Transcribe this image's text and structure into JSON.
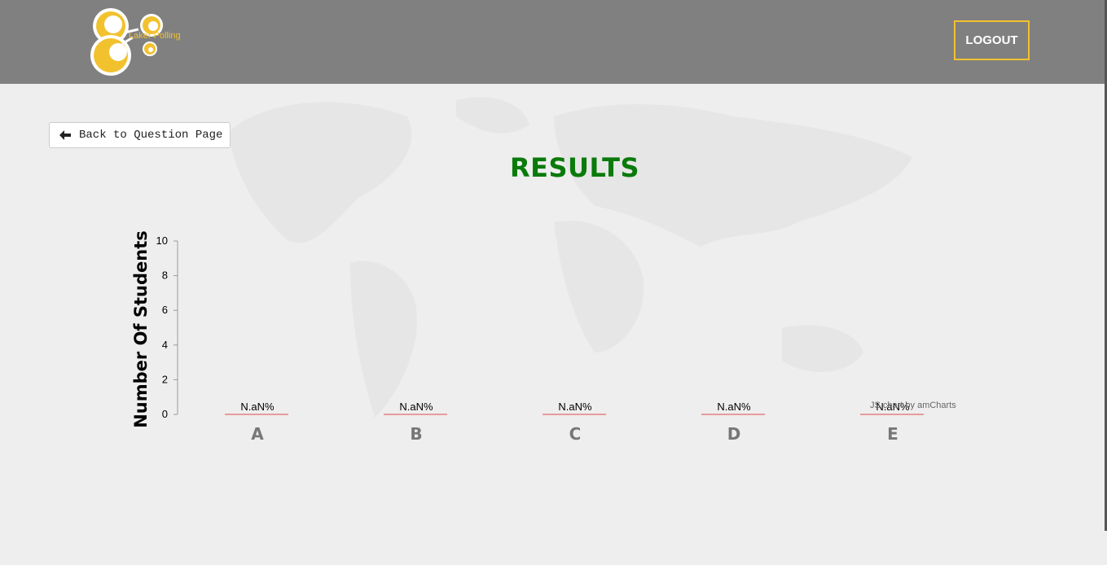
{
  "header": {
    "logo_text": "Laker Polling",
    "logout_label": "LOGOUT"
  },
  "nav": {
    "back_label": "Back to Question Page"
  },
  "page": {
    "title": "RESULTS"
  },
  "credit": "JS chart by amCharts",
  "colors": {
    "header_bg": "#808080",
    "accent_yellow": "#f2c12e",
    "title_green": "#0a7a0a",
    "bar_red": "#e04848"
  },
  "chart_data": {
    "type": "bar",
    "title": "",
    "xlabel": "",
    "ylabel": "Number Of Students",
    "categories": [
      "A",
      "B",
      "C",
      "D",
      "E"
    ],
    "values": [
      0,
      0,
      0,
      0,
      0
    ],
    "value_labels": [
      "N.aN%",
      "N.aN%",
      "N.aN%",
      "N.aN%",
      "N.aN%"
    ],
    "ylim": [
      0,
      10
    ],
    "yticks": [
      0,
      2,
      4,
      6,
      8,
      10
    ],
    "grid": false
  }
}
